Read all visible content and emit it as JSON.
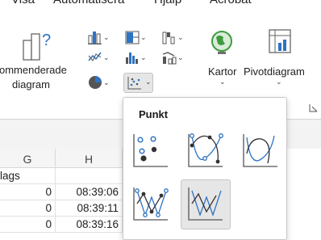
{
  "menu": {
    "items": [
      "Visa",
      "Automatisera",
      "Hjälp",
      "Acrobat"
    ]
  },
  "ribbon": {
    "recommended_label_line1": "ommenderade",
    "recommended_label_line2": "diagram",
    "maps_label": "Kartor",
    "pivot_label": "Pivotdiagram",
    "colors": {
      "accent_blue": "#2e73c2",
      "green": "#3f9b3f",
      "gray": "#707070"
    }
  },
  "dropdown": {
    "title": "Punkt",
    "options": [
      {
        "name": "scatter",
        "icon": "scatter-markers-icon"
      },
      {
        "name": "scatter-smooth-markers",
        "icon": "scatter-smooth-lines-markers-icon"
      },
      {
        "name": "scatter-smooth",
        "icon": "scatter-smooth-lines-icon"
      },
      {
        "name": "scatter-straight-markers",
        "icon": "scatter-straight-lines-markers-icon"
      },
      {
        "name": "scatter-straight",
        "icon": "scatter-straight-lines-icon",
        "selected": true
      }
    ]
  },
  "sheet": {
    "columns": [
      "G",
      "H"
    ],
    "row_label_cell": "lags",
    "rows": [
      {
        "g": "0",
        "h": "08:39:06"
      },
      {
        "g": "0",
        "h": "08:39:11"
      },
      {
        "g": "0",
        "h": "08:39:16"
      }
    ]
  }
}
